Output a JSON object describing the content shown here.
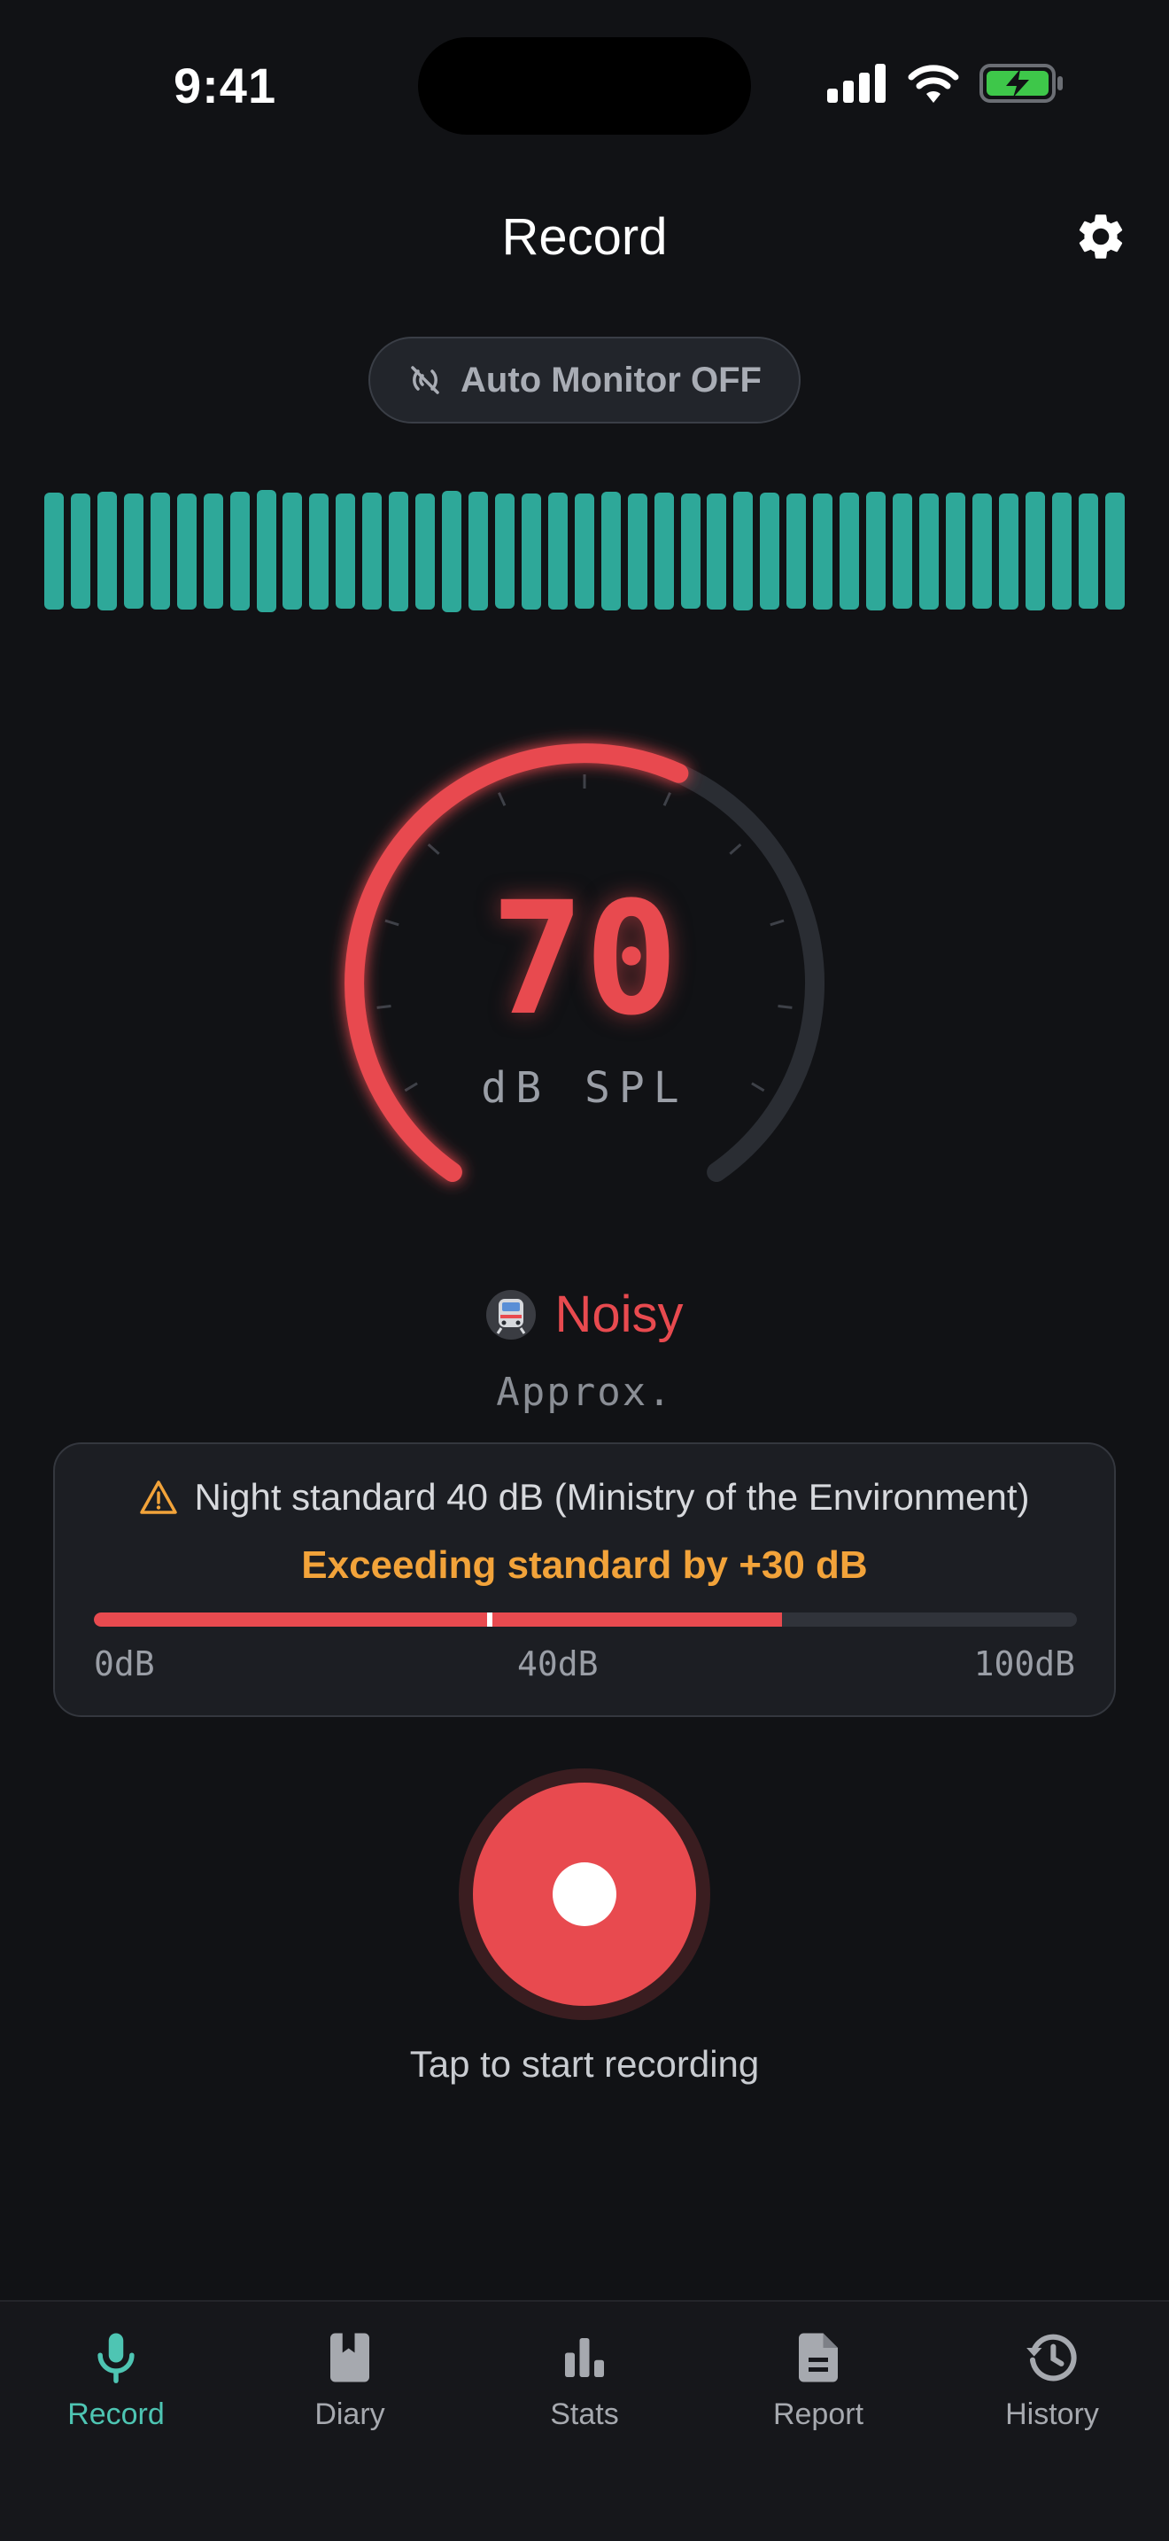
{
  "status_bar": {
    "time": "9:41"
  },
  "header": {
    "title": "Record"
  },
  "auto_monitor": {
    "label": "Auto Monitor OFF"
  },
  "level_bars": [
    0.92,
    0.9,
    0.93,
    0.9,
    0.92,
    0.91,
    0.9,
    0.93,
    0.96,
    0.92,
    0.91,
    0.9,
    0.92,
    0.94,
    0.91,
    0.95,
    0.93,
    0.9,
    0.91,
    0.92,
    0.9,
    0.93,
    0.91,
    0.92,
    0.9,
    0.91,
    0.93,
    0.92,
    0.9,
    0.91,
    0.92,
    0.93,
    0.9,
    0.91,
    0.92,
    0.9,
    0.91,
    0.93,
    0.92,
    0.9,
    0.92
  ],
  "gauge": {
    "value": "70",
    "unit": "dB SPL",
    "min": 0,
    "max": 120,
    "reading": 70
  },
  "level": {
    "label": "Noisy",
    "note": "Approx."
  },
  "standard_card": {
    "heading": "Night standard 40 dB (Ministry of the Environment)",
    "exceed_text": "Exceeding standard by +30 dB",
    "meter_fraction": 0.7,
    "standard_fraction": 0.4,
    "scale": {
      "min": "0dB",
      "mid": "40dB",
      "max": "100dB"
    }
  },
  "record": {
    "hint": "Tap to start recording"
  },
  "tabs": [
    {
      "label": "Record",
      "active": true
    },
    {
      "label": "Diary",
      "active": false
    },
    {
      "label": "Stats",
      "active": false
    },
    {
      "label": "Report",
      "active": false
    },
    {
      "label": "History",
      "active": false
    }
  ],
  "colors": {
    "accent": "#4ec5b3",
    "danger": "#e84a4f",
    "warning": "#f2a33a",
    "bars": "#2ea899",
    "background": "#111215"
  }
}
